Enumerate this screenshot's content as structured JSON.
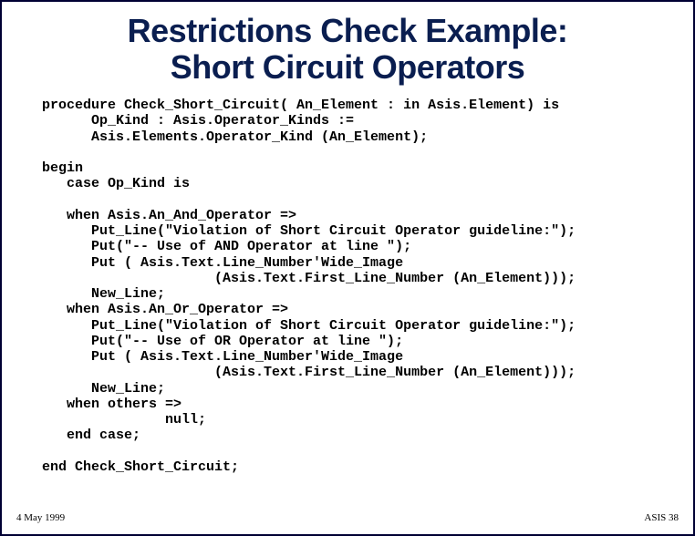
{
  "title_line1": "Restrictions Check Example:",
  "title_line2": "Short Circuit Operators",
  "code": "procedure Check_Short_Circuit( An_Element : in Asis.Element) is\n      Op_Kind : Asis.Operator_Kinds :=\n      Asis.Elements.Operator_Kind (An_Element);\n\nbegin\n   case Op_Kind is\n\n   when Asis.An_And_Operator =>\n      Put_Line(\"Violation of Short Circuit Operator guideline:\");\n      Put(\"-- Use of AND Operator at line \");\n      Put ( Asis.Text.Line_Number'Wide_Image\n                     (Asis.Text.First_Line_Number (An_Element)));\n      New_Line;\n   when Asis.An_Or_Operator =>\n      Put_Line(\"Violation of Short Circuit Operator guideline:\");\n      Put(\"-- Use of OR Operator at line \");\n      Put ( Asis.Text.Line_Number'Wide_Image\n                     (Asis.Text.First_Line_Number (An_Element)));\n      New_Line;\n   when others =>\n               null;\n   end case;\n\nend Check_Short_Circuit;",
  "footer_left": "4 May 1999",
  "footer_right": "ASIS 38"
}
